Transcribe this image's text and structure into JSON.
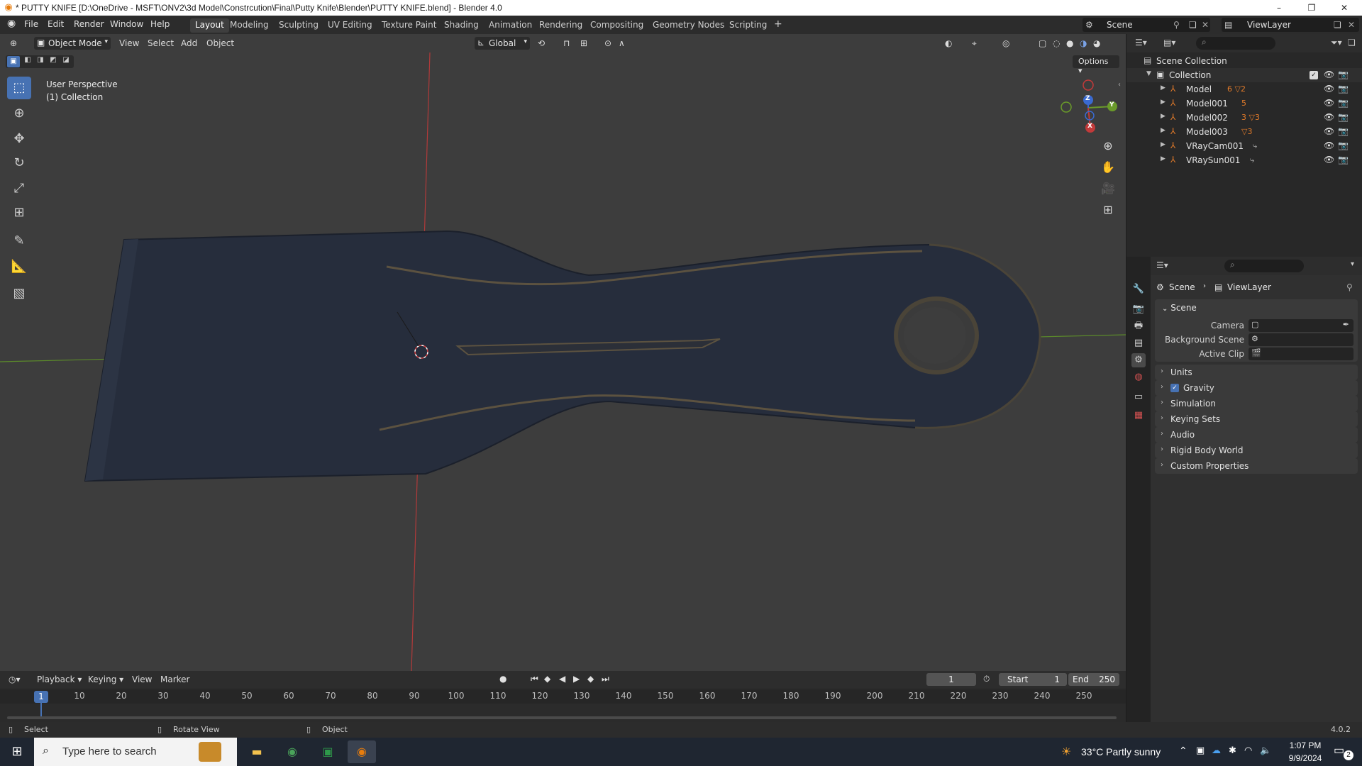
{
  "window": {
    "title": "* PUTTY KNIFE [D:\\OneDrive - MSFT\\ONV2\\3d Model\\Constrcution\\Final\\Putty Knife\\Blender\\PUTTY KNIFE.blend] - Blender 4.0",
    "app_icon": "blender-icon",
    "minimize": "–",
    "maximize": "❐",
    "close": "✕"
  },
  "menus": [
    "File",
    "Edit",
    "Render",
    "Window",
    "Help"
  ],
  "workspaces": [
    {
      "label": "Layout",
      "active": true
    },
    {
      "label": "Modeling",
      "active": false
    },
    {
      "label": "Sculpting",
      "active": false
    },
    {
      "label": "UV Editing",
      "active": false
    },
    {
      "label": "Texture Paint",
      "active": false
    },
    {
      "label": "Shading",
      "active": false
    },
    {
      "label": "Animation",
      "active": false
    },
    {
      "label": "Rendering",
      "active": false
    },
    {
      "label": "Compositing",
      "active": false
    },
    {
      "label": "Geometry Nodes",
      "active": false
    },
    {
      "label": "Scripting",
      "active": false
    }
  ],
  "add_workspace": "+",
  "scene_selector": "Scene",
  "viewlayer_selector": "ViewLayer",
  "viewport": {
    "mode": "Object Mode",
    "menus": [
      "View",
      "Select",
      "Add",
      "Object"
    ],
    "transform_orientation": "Global",
    "options": "Options",
    "info_line1": "User Perspective",
    "info_line2": "(1) Collection",
    "gizmo_axes": {
      "x": "X",
      "y": "Y",
      "z": "Z"
    },
    "object_color": "#262d3c",
    "background_color": "#3d3d3d"
  },
  "outliner": {
    "search_placeholder": "",
    "root": "Scene Collection",
    "collection": "Collection",
    "items": [
      {
        "name": "Model",
        "extra": "6 ▽2"
      },
      {
        "name": "Model001",
        "extra": "5"
      },
      {
        "name": "Model002",
        "extra": "3 ▽3"
      },
      {
        "name": "Model003",
        "extra": "▽3"
      },
      {
        "name": "VRayCam001",
        "extra": ""
      },
      {
        "name": "VRaySun001",
        "extra": ""
      }
    ]
  },
  "properties": {
    "breadcrumb_scene": "Scene",
    "breadcrumb_viewlayer": "ViewLayer",
    "scene_panel": "Scene",
    "fields": [
      {
        "label": "Camera",
        "value": ""
      },
      {
        "label": "Background Scene",
        "value": ""
      },
      {
        "label": "Active Clip",
        "value": ""
      }
    ],
    "subpanels": [
      "Units",
      "Gravity",
      "Simulation",
      "Keying Sets",
      "Audio",
      "Rigid Body World",
      "Custom Properties"
    ],
    "gravity_checked": true
  },
  "timeline": {
    "menus": [
      "Playback",
      "Keying",
      "View",
      "Marker"
    ],
    "current_frame": "1",
    "start_label": "Start",
    "start": "1",
    "end_label": "End",
    "end": "250",
    "ticks": [
      "10",
      "20",
      "30",
      "40",
      "50",
      "60",
      "70",
      "80",
      "90",
      "100",
      "110",
      "120",
      "130",
      "140",
      "150",
      "160",
      "170",
      "180",
      "190",
      "200",
      "210",
      "220",
      "230",
      "240",
      "250"
    ],
    "playhead": "1"
  },
  "statusbar": {
    "select": "Select",
    "rotate": "Rotate View",
    "object": "Object",
    "version": "4.0.2"
  },
  "taskbar": {
    "search_placeholder": "Type here to search",
    "weather": "33°C  Partly sunny",
    "time": "1:07 PM",
    "date": "9/9/2024",
    "notification_count": "2"
  }
}
